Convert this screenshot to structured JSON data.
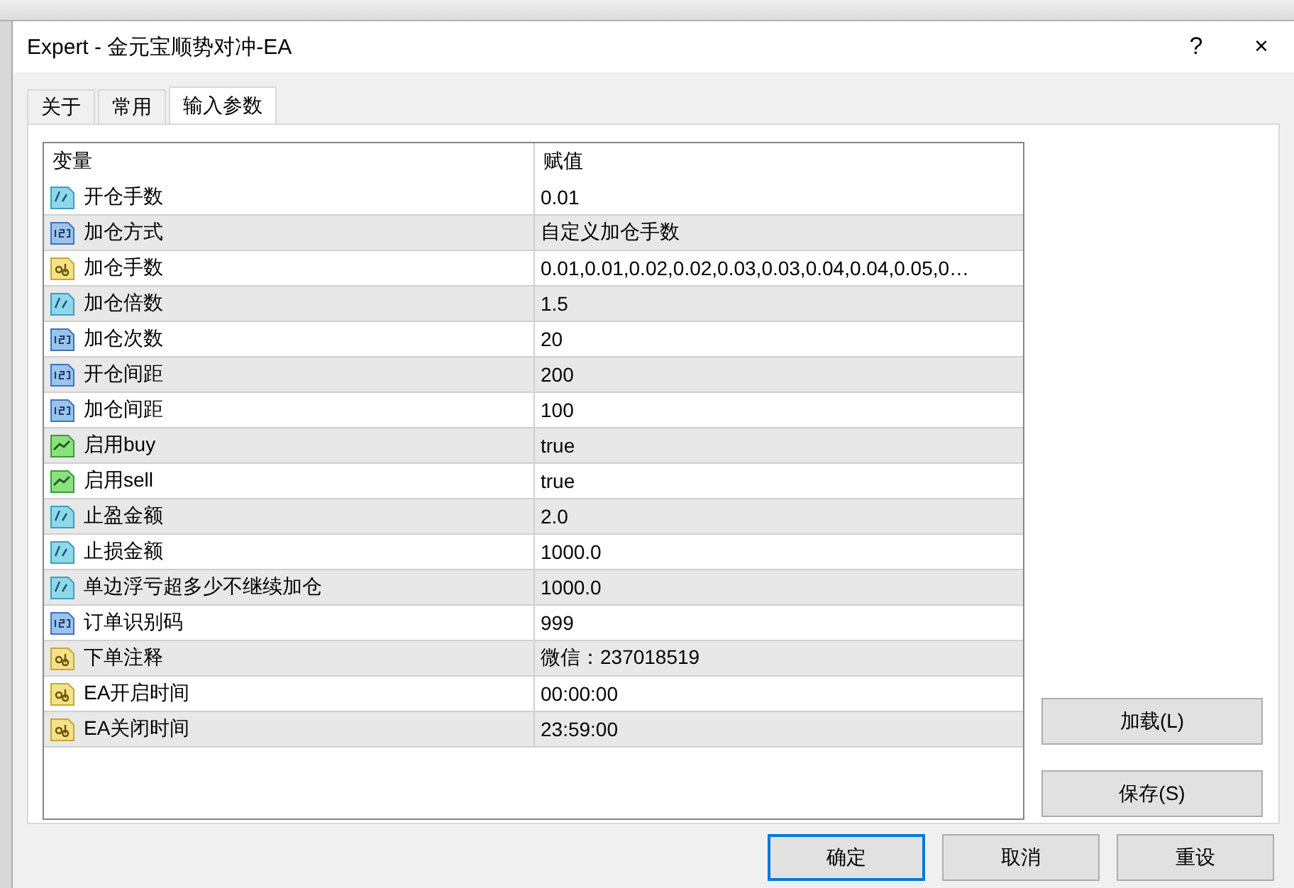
{
  "window": {
    "title": "Expert - 金元宝顺势对冲-EA",
    "help": "?",
    "close": "×"
  },
  "tabs": [
    {
      "label": "关于",
      "selected": false
    },
    {
      "label": "常用",
      "selected": false
    },
    {
      "label": "输入参数",
      "selected": true
    }
  ],
  "table": {
    "columns": [
      "变量",
      "赋值"
    ],
    "rows": [
      {
        "kind": "double",
        "name": "开仓手数",
        "value": "0.01"
      },
      {
        "kind": "int",
        "name": "加仓方式",
        "value": "自定义加仓手数"
      },
      {
        "kind": "string",
        "name": "加仓手数",
        "value": "0.01,0.01,0.02,0.02,0.03,0.03,0.04,0.04,0.05,0…"
      },
      {
        "kind": "double",
        "name": "加仓倍数",
        "value": "1.5"
      },
      {
        "kind": "int",
        "name": "加仓次数",
        "value": "20"
      },
      {
        "kind": "int",
        "name": "开仓间距",
        "value": "200"
      },
      {
        "kind": "int",
        "name": "加仓间距",
        "value": "100"
      },
      {
        "kind": "bool",
        "name": "启用buy",
        "value": "true"
      },
      {
        "kind": "bool",
        "name": "启用sell",
        "value": "true"
      },
      {
        "kind": "double",
        "name": "止盈金额",
        "value": "2.0"
      },
      {
        "kind": "double",
        "name": "止损金额",
        "value": "1000.0"
      },
      {
        "kind": "double",
        "name": "单边浮亏超多少不继续加仓",
        "value": "1000.0"
      },
      {
        "kind": "int",
        "name": "订单识别码",
        "value": "999"
      },
      {
        "kind": "string",
        "name": "下单注释",
        "value": "微信：237018519"
      },
      {
        "kind": "string",
        "name": "EA开启时间",
        "value": "00:00:00"
      },
      {
        "kind": "string",
        "name": "EA关闭时间",
        "value": "23:59:00"
      }
    ]
  },
  "side_buttons": [
    "加载(L)",
    "保存(S)"
  ],
  "buttons": [
    {
      "label": "确定",
      "focused": true
    },
    {
      "label": "取消",
      "focused": false
    },
    {
      "label": "重设",
      "focused": false
    }
  ]
}
